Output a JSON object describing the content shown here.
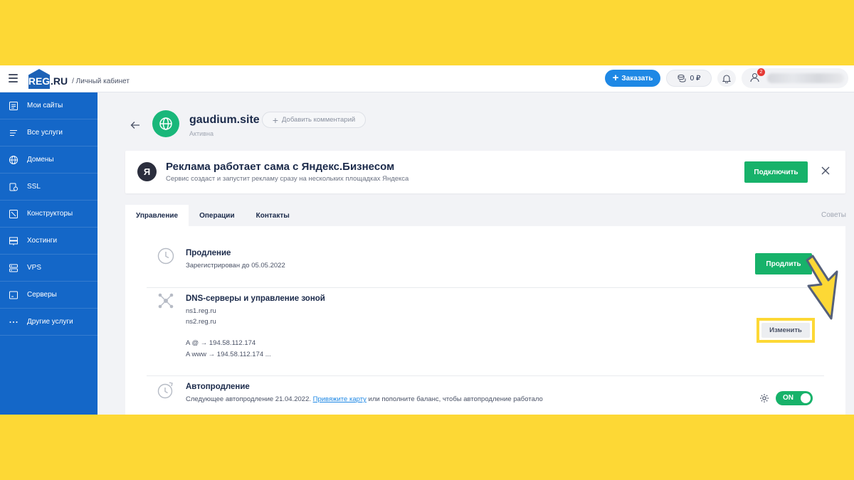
{
  "header": {
    "logo_text": "REG",
    "logo_suffix": ".RU",
    "logo_subtitle": "/ Личный кабинет",
    "order_label": "Заказать",
    "balance": "0 ₽",
    "notifications_count": "2"
  },
  "sidebar": {
    "items": [
      {
        "label": "Мои сайты",
        "icon": "sites-icon"
      },
      {
        "label": "Все услуги",
        "icon": "list-icon"
      },
      {
        "label": "Домены",
        "icon": "globe-icon"
      },
      {
        "label": "SSL",
        "icon": "ssl-icon"
      },
      {
        "label": "Конструкторы",
        "icon": "builder-icon"
      },
      {
        "label": "Хостинги",
        "icon": "hosting-icon"
      },
      {
        "label": "VPS",
        "icon": "vps-icon"
      },
      {
        "label": "Серверы",
        "icon": "server-icon"
      },
      {
        "label": "Другие услуги",
        "icon": "more-icon"
      }
    ]
  },
  "domain": {
    "name": "gaudium.site",
    "status": "Активна",
    "add_comment": "Добавить комментарий"
  },
  "ad": {
    "logo": "Я",
    "title": "Реклама работает сама с Яндекс.Бизнесом",
    "subtitle": "Сервис создаст и запустит рекламу сразу на нескольких площадках Яндекса",
    "button": "Подключить"
  },
  "tabs": [
    {
      "label": "Управление",
      "active": true
    },
    {
      "label": "Операции",
      "active": false
    },
    {
      "label": "Контакты",
      "active": false
    }
  ],
  "tips_label": "Советы",
  "renewal": {
    "title": "Продление",
    "text": "Зарегистрирован до 05.05.2022",
    "button": "Продлить"
  },
  "dns": {
    "title": "DNS-серверы и управление зоной",
    "ns1": "ns1.reg.ru",
    "ns2": "ns2.reg.ru",
    "record1": "A @ → 194.58.112.174",
    "record2": "A www → 194.58.112.174 ...",
    "button": "Изменить"
  },
  "autorenew": {
    "title": "Автопродление",
    "text_before": "Следующее автопродление 21.04.2022.",
    "link": "Привяжите карту",
    "text_after": "или пополните баланс, чтобы автопродление работало",
    "toggle": "ON"
  },
  "colors": {
    "sidebar": "#1467c8",
    "accent_green": "#17b26a",
    "accent_blue": "#1e88e5",
    "highlight_yellow": "#fdd835"
  }
}
